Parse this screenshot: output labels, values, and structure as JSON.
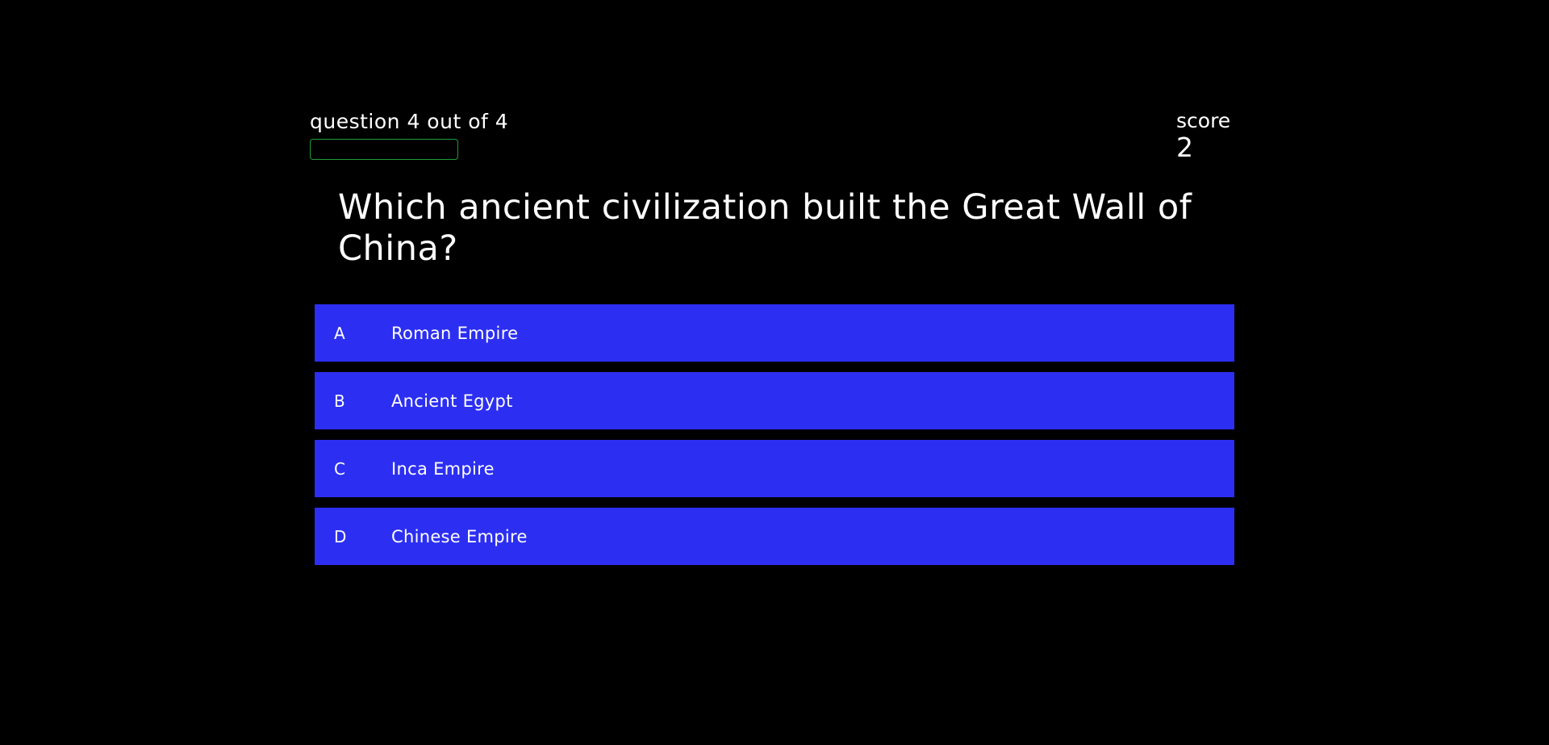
{
  "hud": {
    "progress_text": "question 4 out of 4",
    "progress_fraction": 0,
    "progress_color": "#1f9d3a",
    "score_label": "score",
    "score_value": "2"
  },
  "question": {
    "text": "Which ancient civilization built the Great Wall of China?"
  },
  "choices": [
    {
      "prefix": "A",
      "text": "Roman Empire"
    },
    {
      "prefix": "B",
      "text": "Ancient Egypt"
    },
    {
      "prefix": "C",
      "text": "Inca Empire"
    },
    {
      "prefix": "D",
      "text": "Chinese Empire"
    }
  ],
  "colors": {
    "background": "#000000",
    "choice_background": "#2c2ff2",
    "text": "#ffffff"
  }
}
